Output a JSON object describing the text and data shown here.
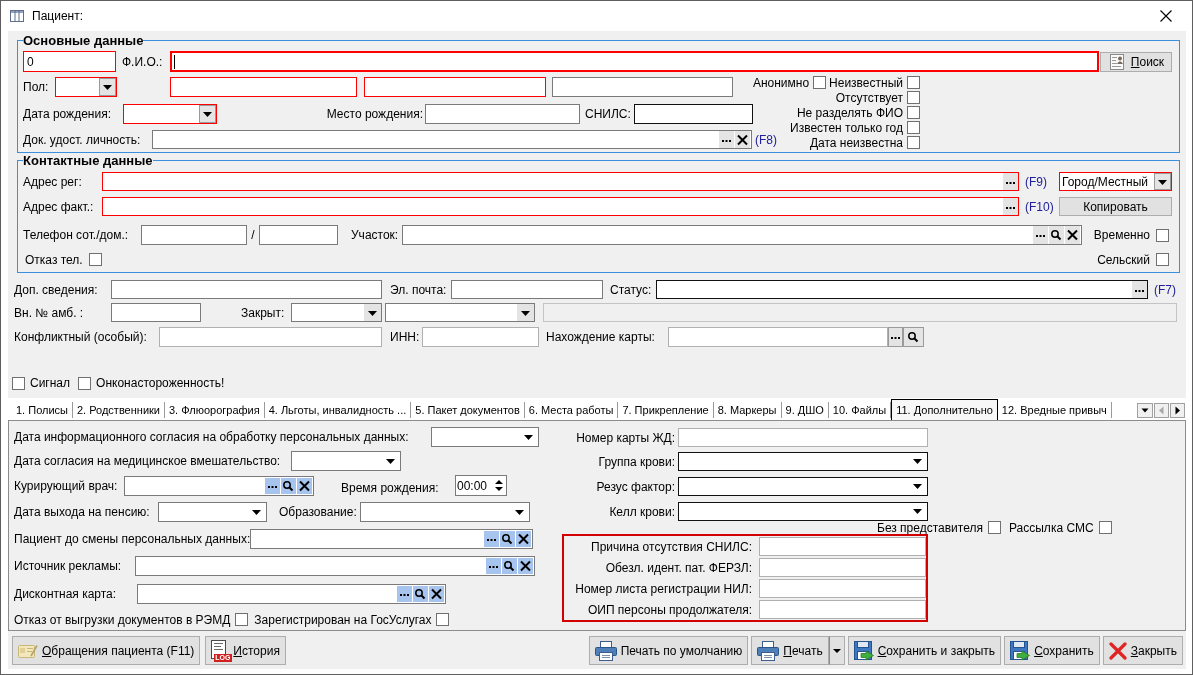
{
  "window": {
    "title": "Пациент:"
  },
  "main_data": {
    "title": "Основные данные",
    "card_number": {
      "value": "0",
      "required": true
    },
    "full_name": {
      "label": "Ф.И.О.:",
      "required": true,
      "focused": true
    },
    "search_button": {
      "label": "Поиск",
      "mnemonic": true
    },
    "sex": {
      "label": "Пол:",
      "required": true
    },
    "name_parts": [
      {
        "required": true
      },
      {
        "required": true
      },
      {
        "required": false
      }
    ],
    "birth_date": {
      "label": "Дата рождения:",
      "required": true
    },
    "birth_place": {
      "label": "Место рождения:"
    },
    "snils": {
      "label": "СНИЛС:"
    },
    "id_document": {
      "label": "Док. удост. личность:",
      "hotkey": "(F8)"
    },
    "flags": [
      {
        "label": "Анонимно",
        "checked": false
      },
      {
        "label": "Неизвестный",
        "checked": false
      },
      {
        "label": "Отсутствует",
        "checked": false
      },
      {
        "label": "Не разделять ФИО",
        "checked": false
      },
      {
        "label": "Известен только год",
        "checked": false
      },
      {
        "label": "Дата неизвестна",
        "checked": false
      }
    ]
  },
  "contact_data": {
    "title": "Контактные данные",
    "address_reg": {
      "label": "Адрес рег:",
      "hotkey": "(F9)",
      "required": true
    },
    "locality_type": {
      "value": "Город/Местный",
      "required": true
    },
    "address_fact": {
      "label": "Адрес факт.:",
      "hotkey": "(F10)",
      "required": true
    },
    "copy_button": {
      "label": "Копировать"
    },
    "phone": {
      "label": "Телефон сот./дом.:",
      "separator": "/"
    },
    "district": {
      "label": "Участок:"
    },
    "temporary": {
      "label": "Временно",
      "checked": false
    },
    "phone_refusal": {
      "label": "Отказ тел.",
      "checked": false
    },
    "rural": {
      "label": "Сельский",
      "checked": false
    }
  },
  "extra": {
    "additional_info": {
      "label": "Доп. сведения:"
    },
    "email": {
      "label": "Эл. почта:"
    },
    "status": {
      "label": "Статус:",
      "hotkey": "(F7)"
    },
    "outpatient_number": {
      "label": "Вн. № амб. :"
    },
    "closed": {
      "label": "Закрыт:"
    },
    "closed_comment": {
      "disabled": true
    },
    "conflict": {
      "label": "Конфликтный (особый):"
    },
    "inn": {
      "label": "ИНН:"
    },
    "card_location": {
      "label": "Нахождение карты:"
    },
    "markers": [
      {
        "label": "Сигнал",
        "checked": false
      },
      {
        "label": "Онконастороженность!",
        "checked": false
      }
    ]
  },
  "tabs": [
    {
      "label": "1. Полисы",
      "selected": false
    },
    {
      "label": "2. Родственники",
      "selected": false
    },
    {
      "label": "3. Флюорография",
      "selected": false
    },
    {
      "label": "4. Льготы, инвалидность ...",
      "selected": false
    },
    {
      "label": "5. Пакет документов",
      "selected": false
    },
    {
      "label": "6. Места работы",
      "selected": false
    },
    {
      "label": "7. Прикрепление",
      "selected": false
    },
    {
      "label": "8. Маркеры",
      "selected": false
    },
    {
      "label": "9. ДШО",
      "selected": false
    },
    {
      "label": "10. Файлы",
      "selected": false
    },
    {
      "label": "11. Дополнительно",
      "selected": true
    },
    {
      "label": "12. Вредные привыч",
      "selected": false
    }
  ],
  "tab_scroller": {
    "previous_disabled": true,
    "next_disabled": false
  },
  "additional_tab": {
    "consent_pd_date": {
      "label": "Дата информационного согласия на обработку персональных данных:"
    },
    "consent_medical_date": {
      "label": "Дата согласия на медицинское вмешательство:"
    },
    "curator": {
      "label": "Курирующий врач:"
    },
    "birth_time": {
      "label": "Время рождения:",
      "value": "00:00"
    },
    "retirement_date": {
      "label": "Дата выхода на пенсию:"
    },
    "education": {
      "label": "Образование:"
    },
    "previous_patient": {
      "label": "Пациент до смены персональных данных:"
    },
    "ad_source": {
      "label": "Источник рекламы:"
    },
    "discount_card": {
      "label": "Дисконтная карта:"
    },
    "flags": [
      {
        "label": "Отказ от выгрузки документов в РЭМД",
        "checked": false
      },
      {
        "label": "Зарегистрирован на ГосУслугах",
        "checked": false
      }
    ],
    "rzd_card": {
      "label": "Номер карты ЖД:"
    },
    "blood_group": {
      "label": "Группа крови:"
    },
    "rhesus": {
      "label": "Резус фактор:"
    },
    "kell": {
      "label": "Келл крови:"
    },
    "options": [
      {
        "label": "Без представителя",
        "checked": false
      },
      {
        "label": "Рассылка СМС",
        "checked": false
      }
    ],
    "identity_group": {
      "highlighted": true,
      "fields": [
        {
          "label": "Причина отсутствия СНИЛС:"
        },
        {
          "label": "Обезл. идент. пат. ФЕРЗЛ:"
        },
        {
          "label": "Номер листа регистрации НИЛ:"
        },
        {
          "label": "ОИП персоны продолжателя:"
        }
      ]
    }
  },
  "footer": {
    "left_buttons": [
      {
        "kind": "card",
        "label": "Обращения пациента (F11)",
        "mnemonic": true
      },
      {
        "kind": "log",
        "label": "История",
        "badge": "LOG",
        "mnemonic": true
      }
    ],
    "right_buttons": [
      {
        "kind": "printer",
        "label": "Печать по умолчанию",
        "mnemonic": false,
        "split": false
      },
      {
        "kind": "printer",
        "label": "Печать",
        "mnemonic": true,
        "split": true
      },
      {
        "kind": "save",
        "label": "Сохранить и закрыть",
        "mnemonic": true,
        "split": false
      },
      {
        "kind": "save",
        "label": "Сохранить",
        "mnemonic": true,
        "split": false
      },
      {
        "kind": "close",
        "label": "Закрыть",
        "mnemonic": true,
        "split": false
      }
    ]
  }
}
